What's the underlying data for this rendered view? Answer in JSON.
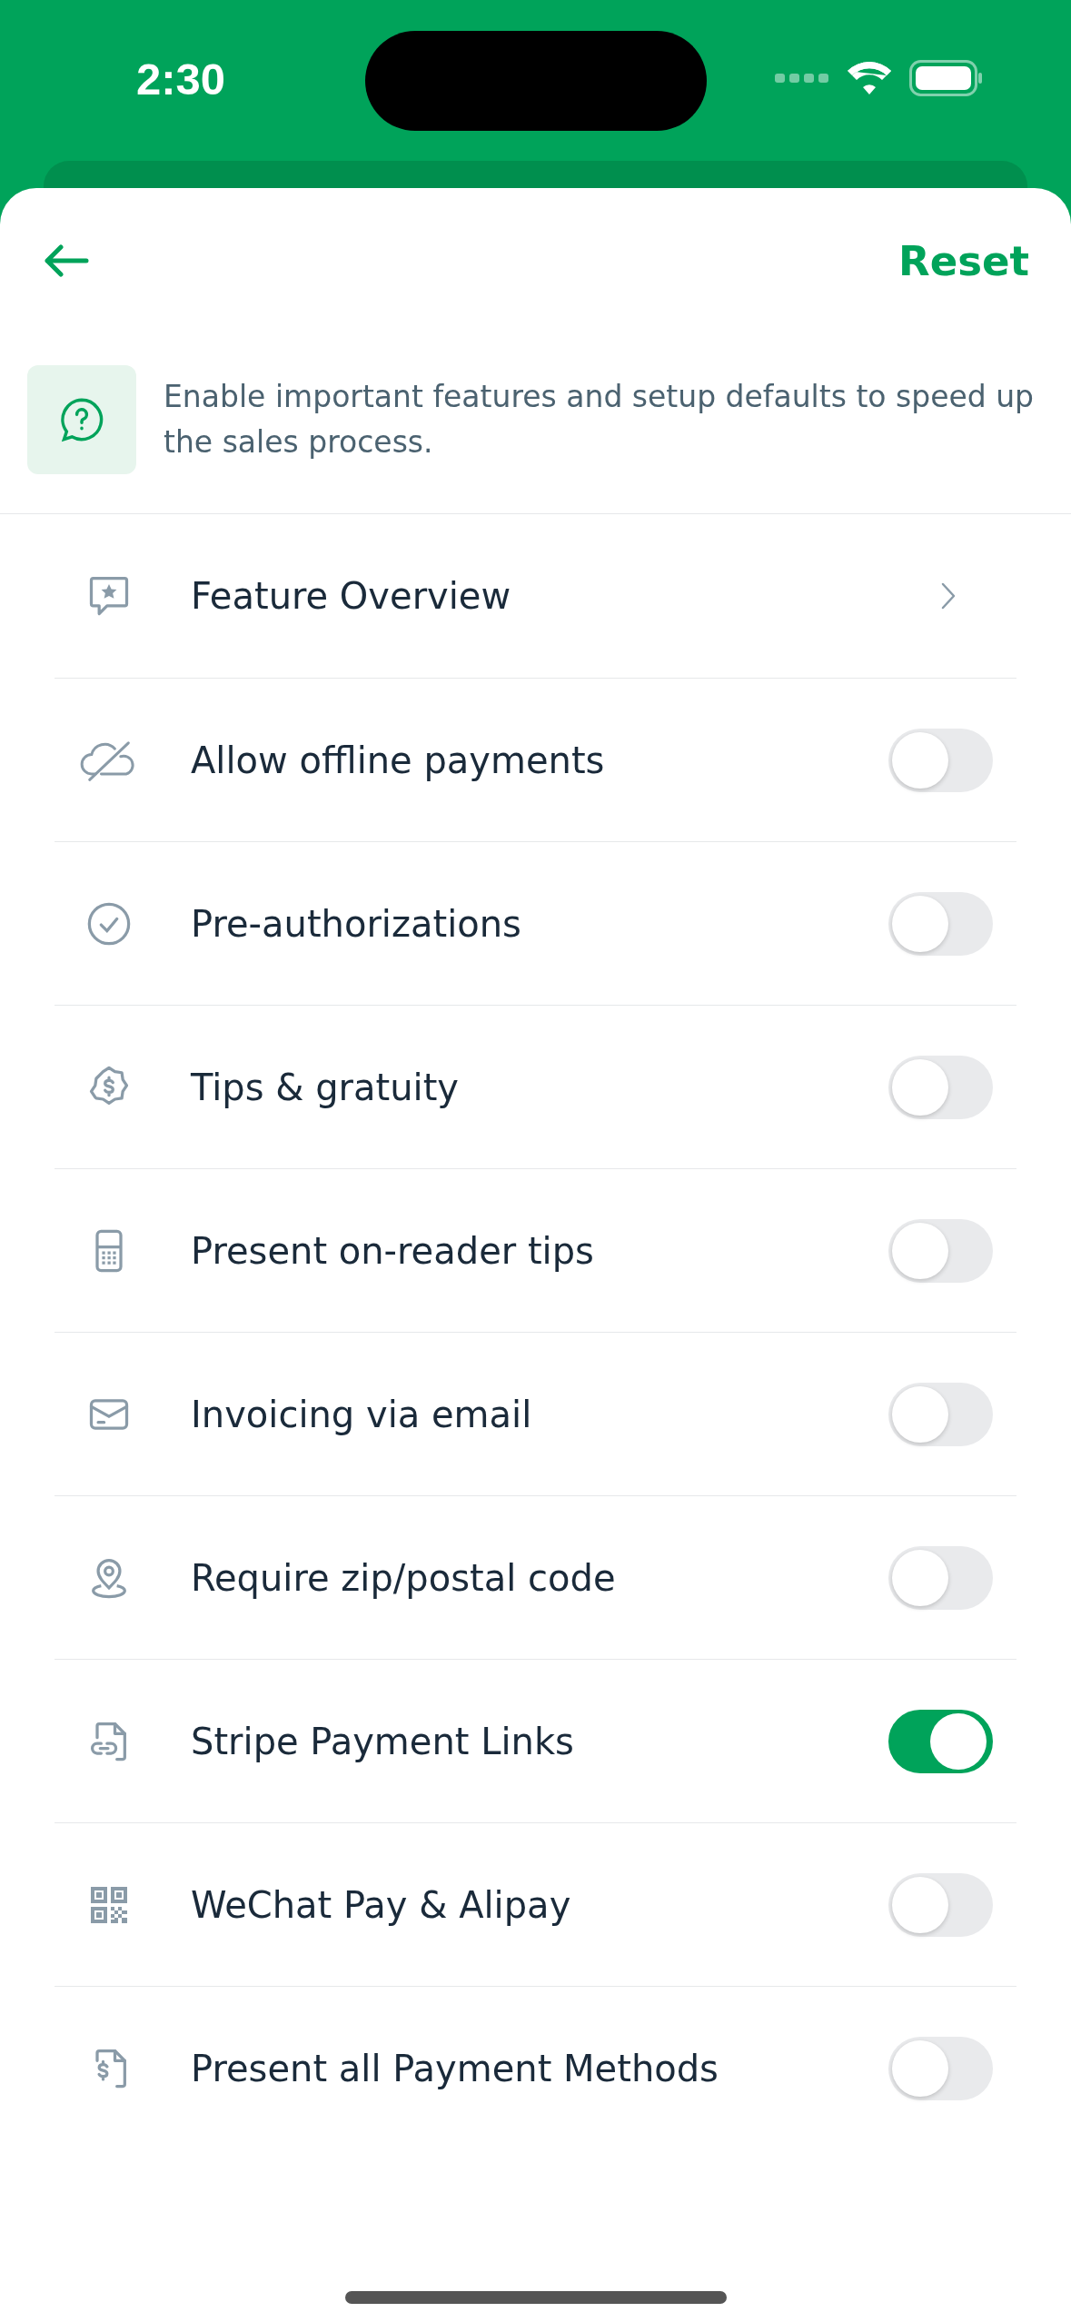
{
  "status_bar": {
    "time": "2:30"
  },
  "header": {
    "reset": "Reset"
  },
  "info": {
    "text": "Enable important features and setup defaults to speed up the sales process."
  },
  "rows": [
    {
      "kind": "link",
      "label": "Feature Overview"
    },
    {
      "kind": "toggle",
      "label": "Allow offline payments",
      "on": false
    },
    {
      "kind": "toggle",
      "label": "Pre-authorizations",
      "on": false
    },
    {
      "kind": "toggle",
      "label": "Tips & gratuity",
      "on": false
    },
    {
      "kind": "toggle",
      "label": "Present on-reader tips",
      "on": false
    },
    {
      "kind": "toggle",
      "label": "Invoicing via email",
      "on": false
    },
    {
      "kind": "toggle",
      "label": "Require zip/postal code",
      "on": false
    },
    {
      "kind": "toggle",
      "label": "Stripe Payment Links",
      "on": true
    },
    {
      "kind": "toggle",
      "label": "WeChat Pay & Alipay",
      "on": false
    },
    {
      "kind": "toggle",
      "label": "Present all Payment Methods",
      "on": false
    }
  ]
}
